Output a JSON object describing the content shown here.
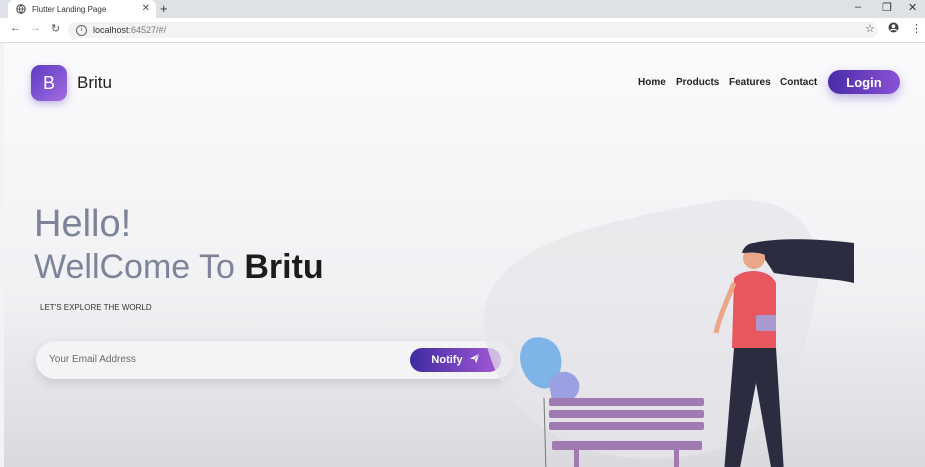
{
  "browser": {
    "tab_title": "Flutter Landing Page",
    "tab_close": "✕",
    "new_tab": "+",
    "url_host": "localhost",
    "url_rest": ":64527/#/"
  },
  "site": {
    "logo_letter": "B",
    "brand": "Britu",
    "nav": [
      "Home",
      "Products",
      "Features",
      "Contact"
    ],
    "login": "Login"
  },
  "hero": {
    "line1": "Hello!",
    "line2_prefix": "WellCome To ",
    "line2_brand": "Britu",
    "subtitle": "LET'S EXPLORE THE WORLD",
    "email_placeholder": "Your Email Address",
    "notify": "Notify"
  },
  "colors": {
    "accent": "#5b3cc4",
    "accent_light": "#a56ce0"
  },
  "icons": [
    "globe-icon",
    "back-icon",
    "forward-icon",
    "reload-icon",
    "info-icon",
    "star-icon",
    "account-icon",
    "menu-icon",
    "send-icon"
  ]
}
